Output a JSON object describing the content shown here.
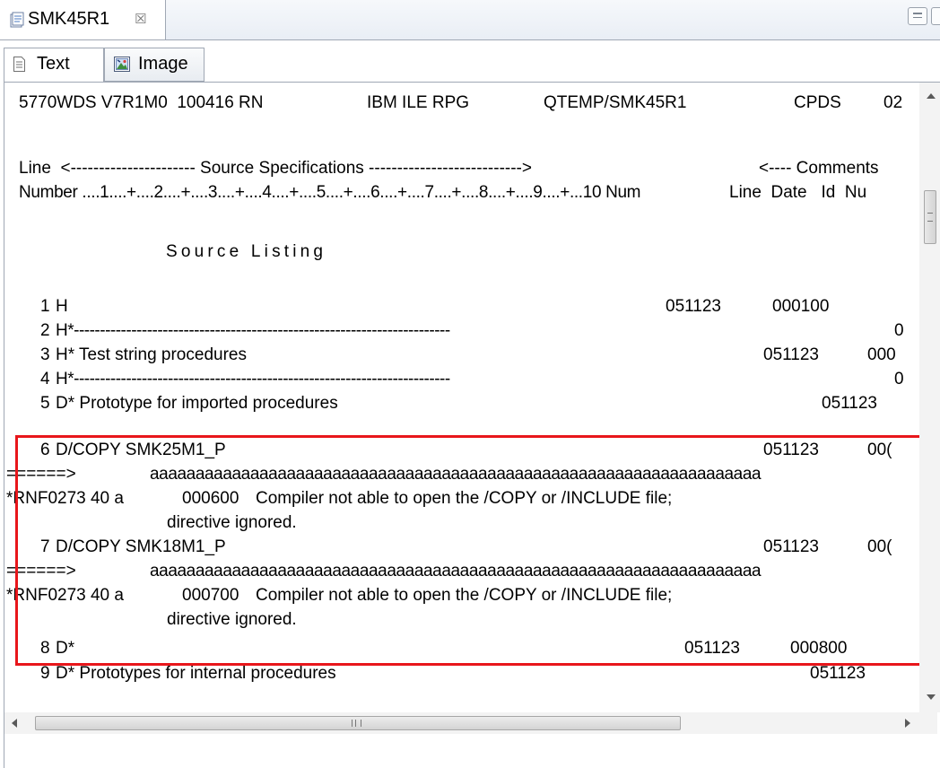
{
  "editor_tab": {
    "title": "SMK45R1",
    "close_glyph": "☒"
  },
  "subtabs": {
    "text_label": "Text",
    "image_label": "Image"
  },
  "listing": {
    "header": {
      "product": "5770WDS V7R1M0  100416 RN",
      "compiler": "IBM ILE RPG",
      "object": "QTEMP/SMK45R1",
      "format": "CPDS",
      "page": "02"
    },
    "column_headers": {
      "line1_left": "Line  <---------------------- Source Specifications --------------------------->",
      "line1_right": "<---- Comments",
      "line2_left": "Number ....1....+....2....+....3....+....4....+....5....+....6....+....7....+....8....+....9....+...10 Num",
      "line2_right": "Line  Date   Id  Nu"
    },
    "section_title": "Source Listing",
    "rows": [
      {
        "num": "1",
        "text": "H",
        "date": "051123",
        "seq": "000100"
      },
      {
        "num": "2",
        "text": "H*------------------------------------------------------------------------",
        "tail": "0"
      },
      {
        "num": "3",
        "text": "H* Test string procedures",
        "date": "051123",
        "seq": "000"
      },
      {
        "num": "4",
        "text": "H*------------------------------------------------------------------------",
        "tail": "0"
      },
      {
        "num": "5",
        "text": "D* Prototype for imported procedures",
        "date": "051123"
      },
      {
        "num": "6",
        "text": "D/COPY SMK25M1_P",
        "date": "051123",
        "seq": "00("
      }
    ],
    "error_blocks": [
      {
        "marker": "======>",
        "a_run": "aaaaaaaaaaaaaaaaaaaaaaaaaaaaaaaaaaaaaaaaaaaaaaaaaaaaaaaaaaaaaaaaaaa",
        "msg_id": "*RNF0273 40 a",
        "seq": "000600",
        "message": "Compiler not able to open the /COPY or /INCLUDE file;",
        "message_cont": "directive ignored."
      },
      {
        "marker": "======>",
        "a_run": "aaaaaaaaaaaaaaaaaaaaaaaaaaaaaaaaaaaaaaaaaaaaaaaaaaaaaaaaaaaaaaaaaaa",
        "msg_id": "*RNF0273 40 a",
        "seq": "000700",
        "message": "Compiler not able to open the /COPY or /INCLUDE file;",
        "message_cont": "directive ignored."
      }
    ],
    "row7": {
      "num": "7",
      "text": "D/COPY SMK18M1_P",
      "date": "051123",
      "seq": "00("
    },
    "row8": {
      "num": "8",
      "text": "D*",
      "date": "051123",
      "seq": "000800"
    },
    "row9": {
      "num": "9",
      "text": "D* Prototypes for internal procedures",
      "date": "051123"
    }
  },
  "colors": {
    "highlight": "#e8161b"
  },
  "icons": {
    "file": "source-member-icon",
    "text_tab": "document-icon",
    "image_tab": "image-icon"
  }
}
